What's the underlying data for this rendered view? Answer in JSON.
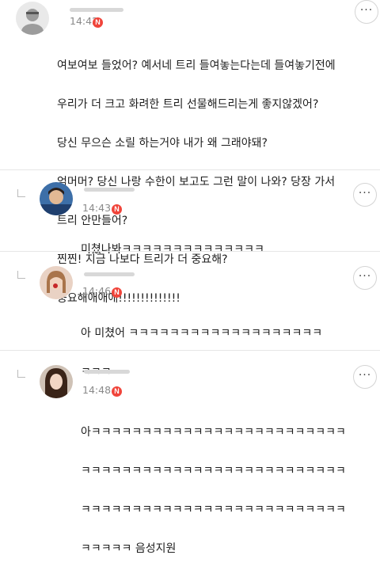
{
  "comments": [
    {
      "time": "14:42",
      "badge": "N",
      "more": "···",
      "avatar": "default-avatar",
      "lines": [
        "여보여보 들었어? 예서네 트리 들여놓는다는데 들여놓기전에",
        "우리가 더 크고 화려한 트리 선물해드리는게 좋지않겠어?",
        "당신 무으슨 소릴 하는거야 내가 왜 그래야돼?",
        "엄머머? 당신 나랑 수한이 보고도 그런 말이 나와? 당장 가서",
        "트리 안만들어?",
        "찐찐! 지금 나보다 트리가 더 중요해?",
        "중요해애애애!!!!!!!!!!!!!!"
      ]
    },
    {
      "time": "14:43",
      "badge": "N",
      "more": "···",
      "avatar": "profile-photo",
      "lines": [
        "미쳤나봐ㅋㅋㅋㅋㅋㅋㅋㅋㅋㅋㅋㅋㅋㅋ"
      ]
    },
    {
      "time": "14:46",
      "badge": "N",
      "more": "···",
      "avatar": "profile-photo",
      "lines": [
        "아 미쳤어 ㅋㅋㅋㅋㅋㅋㅋㅋㅋㅋㅋㅋㅋㅋㅋㅋㅋㅋㅋ",
        "ㅋㅋㅋ"
      ]
    },
    {
      "time": "14:48",
      "badge": "N",
      "more": "···",
      "avatar": "profile-photo",
      "lines": [
        "아ㅋㅋㅋㅋㅋㅋㅋㅋㅋㅋㅋㅋㅋㅋㅋㅋㅋㅋㅋㅋㅋㅋㅋㅋㅋ",
        "ㅋㅋㅋㅋㅋㅋㅋㅋㅋㅋㅋㅋㅋㅋㅋㅋㅋㅋㅋㅋㅋㅋㅋㅋㅋㅋ",
        "ㅋㅋㅋㅋㅋㅋㅋㅋㅋㅋㅋㅋㅋㅋㅋㅋㅋㅋㅋㅋㅋㅋㅋㅋㅋㅋ",
        "ㅋㅋㅋㅋㅋ 음성지원"
      ]
    }
  ],
  "colors": {
    "badge": "#f0443a",
    "time": "#8a8a8a",
    "divider": "#e6e6e6"
  }
}
